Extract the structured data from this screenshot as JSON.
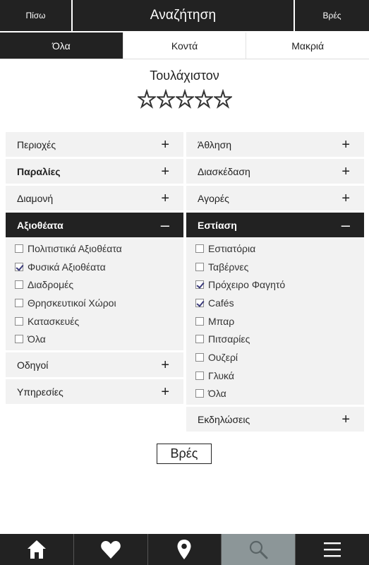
{
  "header": {
    "back_label": "Πίσω",
    "title": "Αναζήτηση",
    "find_label": "Βρές"
  },
  "tabs": [
    {
      "label": "Όλα",
      "active": true
    },
    {
      "label": "Κοντά",
      "active": false
    },
    {
      "label": "Μακριά",
      "active": false
    }
  ],
  "rating": {
    "label": "Τουλάχιστον",
    "max_stars": 5,
    "selected": 0
  },
  "left_sections": [
    {
      "label": "Περιοχές",
      "sign": "+"
    },
    {
      "label": "Παραλίες",
      "sign": "+"
    },
    {
      "label": "Διαμονή",
      "sign": "+"
    },
    {
      "label": "Αξιοθέατα",
      "sign": "–"
    },
    {
      "label": "Οδηγοί",
      "sign": "+"
    },
    {
      "label": "Υπηρεσίες",
      "sign": "+"
    }
  ],
  "left_options": [
    {
      "label": "Πολιτιστικά Αξιοθέατα",
      "checked": false
    },
    {
      "label": "Φυσικά Αξιοθέατα",
      "checked": true
    },
    {
      "label": "Διαδρομές",
      "checked": false
    },
    {
      "label": "Θρησκευτικοί Χώροι",
      "checked": false
    },
    {
      "label": "Κατασκευές",
      "checked": false
    },
    {
      "label": "Όλα",
      "checked": false
    }
  ],
  "right_sections": [
    {
      "label": "Άθληση",
      "sign": "+"
    },
    {
      "label": "Διασκέδαση",
      "sign": "+"
    },
    {
      "label": "Αγορές",
      "sign": "+"
    },
    {
      "label": "Εστίαση",
      "sign": "–"
    },
    {
      "label": "Εκδηλώσεις",
      "sign": "+"
    }
  ],
  "right_options": [
    {
      "label": "Εστιατόρια",
      "checked": false
    },
    {
      "label": "Ταβέρνες",
      "checked": false
    },
    {
      "label": "Πρόχειρο Φαγητό",
      "checked": true
    },
    {
      "label": "Cafés",
      "checked": true
    },
    {
      "label": "Μπαρ",
      "checked": false
    },
    {
      "label": "Πιτσαρίες",
      "checked": false
    },
    {
      "label": "Ουζερί",
      "checked": false
    },
    {
      "label": "Γλυκά",
      "checked": false
    },
    {
      "label": "Όλα",
      "checked": false
    }
  ],
  "find_button_label": "Βρές",
  "bottom_nav": [
    {
      "icon": "home-icon",
      "active": false
    },
    {
      "icon": "heart-icon",
      "active": false
    },
    {
      "icon": "map-pin-icon",
      "active": false
    },
    {
      "icon": "search-icon",
      "active": true
    },
    {
      "icon": "menu-icon",
      "active": false
    }
  ],
  "colors": {
    "bar_background": "#222222",
    "panel_background": "#f2f2f2",
    "active_nav": "#8c9698"
  }
}
